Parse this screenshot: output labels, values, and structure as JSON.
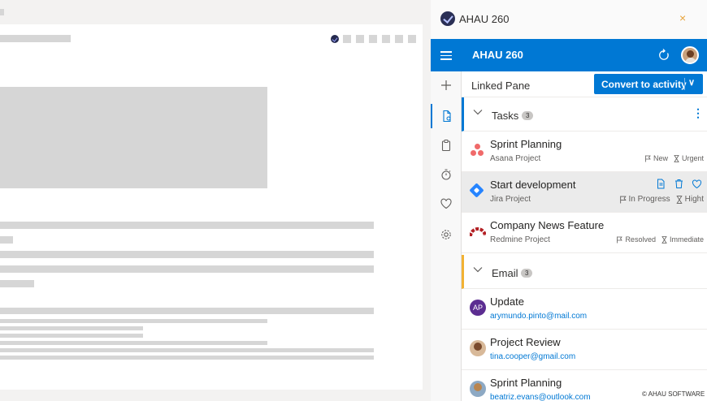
{
  "app": {
    "window_title": "AHAU 260",
    "header_title": "AHAU 260",
    "close_glyph": "×",
    "footer": "© AHAU SOFTWARE"
  },
  "linked": {
    "label": "Linked Pane",
    "convert_label": "Convert to activity",
    "convert_chevron": "∨"
  },
  "rail": {
    "icons": [
      "menu-icon",
      "add-icon",
      "document-link-icon",
      "clipboard-icon",
      "timer-icon",
      "heart-icon",
      "settings-icon"
    ]
  },
  "sections": {
    "tasks": {
      "label": "Tasks",
      "count": "3",
      "more": "⋮"
    },
    "email": {
      "label": "Email",
      "count": "3"
    }
  },
  "tasks": [
    {
      "title": "Sprint Planning",
      "project": "Asana Project",
      "status": "New",
      "priority": "Urgent",
      "icon": "asana-icon"
    },
    {
      "title": "Start development",
      "project": "Jira Project",
      "status": "In Progress",
      "priority": "Hight",
      "icon": "jira-icon"
    },
    {
      "title": "Company News Feature",
      "project": "Redmine Project",
      "status": "Resolved",
      "priority": "Immediate",
      "icon": "redmine-icon"
    }
  ],
  "emails": [
    {
      "subject": "Update",
      "address": "arymundo.pinto@mail.com",
      "initials": "AP"
    },
    {
      "subject": "Project Review",
      "address": "tina.cooper@gmail.com"
    },
    {
      "subject": "Sprint Planning",
      "address": "beatriz.evans@outlook.com"
    }
  ],
  "colors": {
    "accent": "#0078d4",
    "email_accent": "#f2b233",
    "close": "#e8a33a"
  }
}
